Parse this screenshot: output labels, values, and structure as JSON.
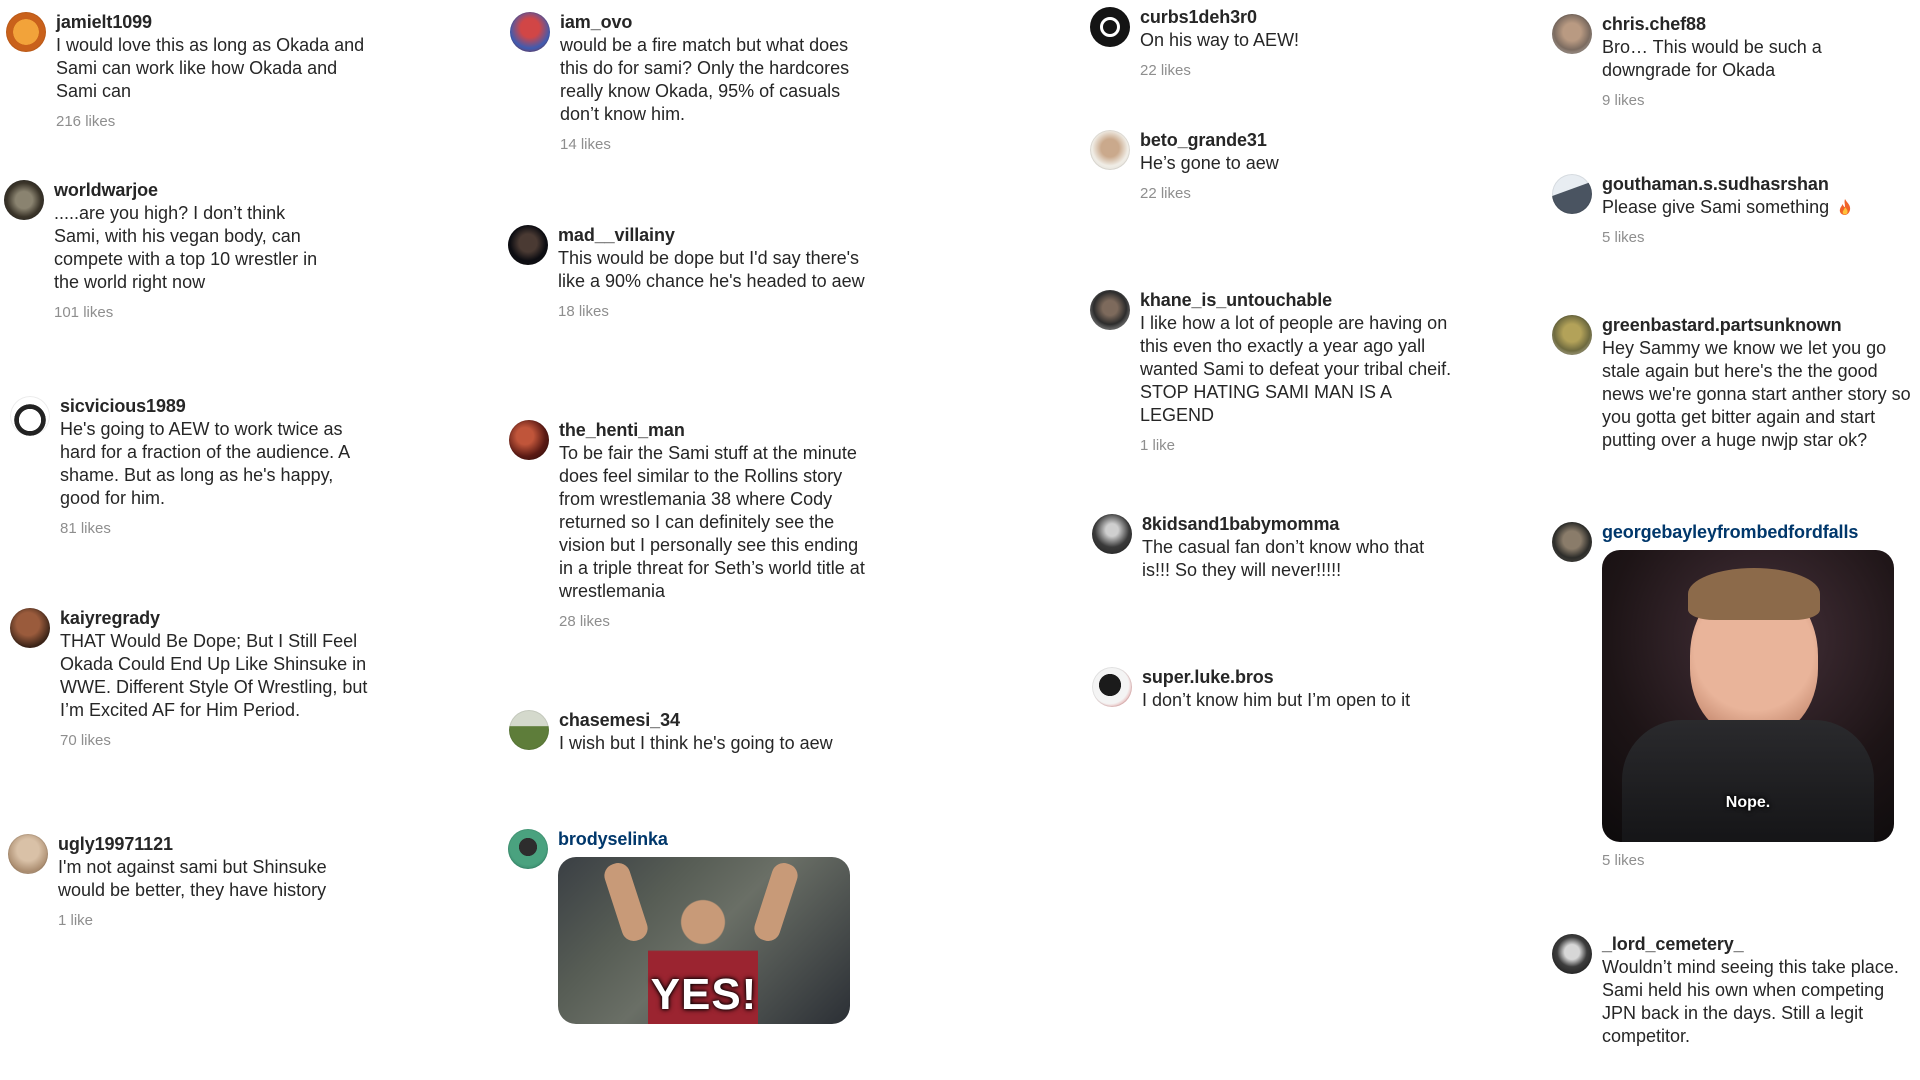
{
  "comments": [
    {
      "username": "jamielt1099",
      "text": "I would love this as long as Okada and Sami can work like how Okada and Sami can",
      "likes": "216 likes"
    },
    {
      "username": "worldwarjoe",
      "text": ".....are you high? I don’t think Sami, with his vegan body, can compete with a top 10 wrestler in the world right now",
      "likes": "101 likes"
    },
    {
      "username": "sicvicious1989",
      "text": "He's going to AEW to work twice as hard for a fraction of the audience. A shame. But as long as he's happy, good for him.",
      "likes": "81 likes"
    },
    {
      "username": "kaiyregrady",
      "text": "THAT Would Be Dope; But I Still Feel Okada Could End Up Like Shinsuke in WWE. Different Style Of Wrestling, but I’m Excited AF for Him Period.",
      "likes": "70 likes"
    },
    {
      "username": "ugly19971121",
      "text": "I'm not against sami but Shinsuke would be better, they have history",
      "likes": "1 like"
    },
    {
      "username": "iam_ovo",
      "text": "would be a fire match but what does this do for sami? Only the hardcores really know Okada, 95% of casuals don’t know him.",
      "likes": "14 likes"
    },
    {
      "username": "mad__villainy",
      "text": "This would be dope but I'd say there's like a 90% chance he's headed to aew",
      "likes": "18 likes"
    },
    {
      "username": "the_henti_man",
      "text": "To be fair the Sami stuff at the minute does feel similar to the Rollins story from wrestlemania 38 where Cody returned so I can definitely see the vision but I personally see this ending in a triple threat for Seth’s world title at wrestlemania",
      "likes": "28 likes"
    },
    {
      "username": "chasemesi_34",
      "text": "I wish but I think he's going to aew",
      "likes": ""
    },
    {
      "username": "brodyselinka",
      "gif_caption": "YES!",
      "likes": ""
    },
    {
      "username": "curbs1deh3r0",
      "text": "On his way to AEW!",
      "likes": "22 likes"
    },
    {
      "username": "beto_grande31",
      "text": "He’s gone to aew",
      "likes": "22 likes"
    },
    {
      "username": "khane_is_untouchable",
      "text": "I like how a lot of people are having on this even tho exactly a year ago yall wanted Sami to defeat your tribal cheif. STOP HATING SAMI MAN IS A LEGEND",
      "likes": "1 like"
    },
    {
      "username": "8kidsand1babymomma",
      "text": "The casual fan don’t know who that is!!! So they will never!!!!!",
      "likes": ""
    },
    {
      "username": "super.luke.bros",
      "text": "I don’t know him but I’m open to it",
      "likes": ""
    },
    {
      "username": "chris.chef88",
      "text": "Bro… This would be such a downgrade for Okada",
      "likes": "9 likes"
    },
    {
      "username": "gouthaman.s.sudhasrshan",
      "text": "Please give Sami something",
      "likes": "5 likes"
    },
    {
      "username": "greenbastard.partsunknown",
      "text": "Hey Sammy we know we let you go stale again but here's the the good news we're gonna start anther story so you gotta get bitter again and start putting over a huge nwjp star ok?",
      "likes": ""
    },
    {
      "username": "georgebayleyfrombedfordfalls",
      "gif_caption": "Nope.",
      "likes": "5 likes"
    },
    {
      "username": "_lord_cemetery_",
      "text": "Wouldn’t mind seeing this take place. Sami held his own when competing JPN back in the days. Still a legit competitor.",
      "likes": ""
    }
  ],
  "colors": {
    "text": "#262626",
    "muted": "#8e8e8e",
    "link": "#00376b",
    "background": "#ffffff"
  }
}
